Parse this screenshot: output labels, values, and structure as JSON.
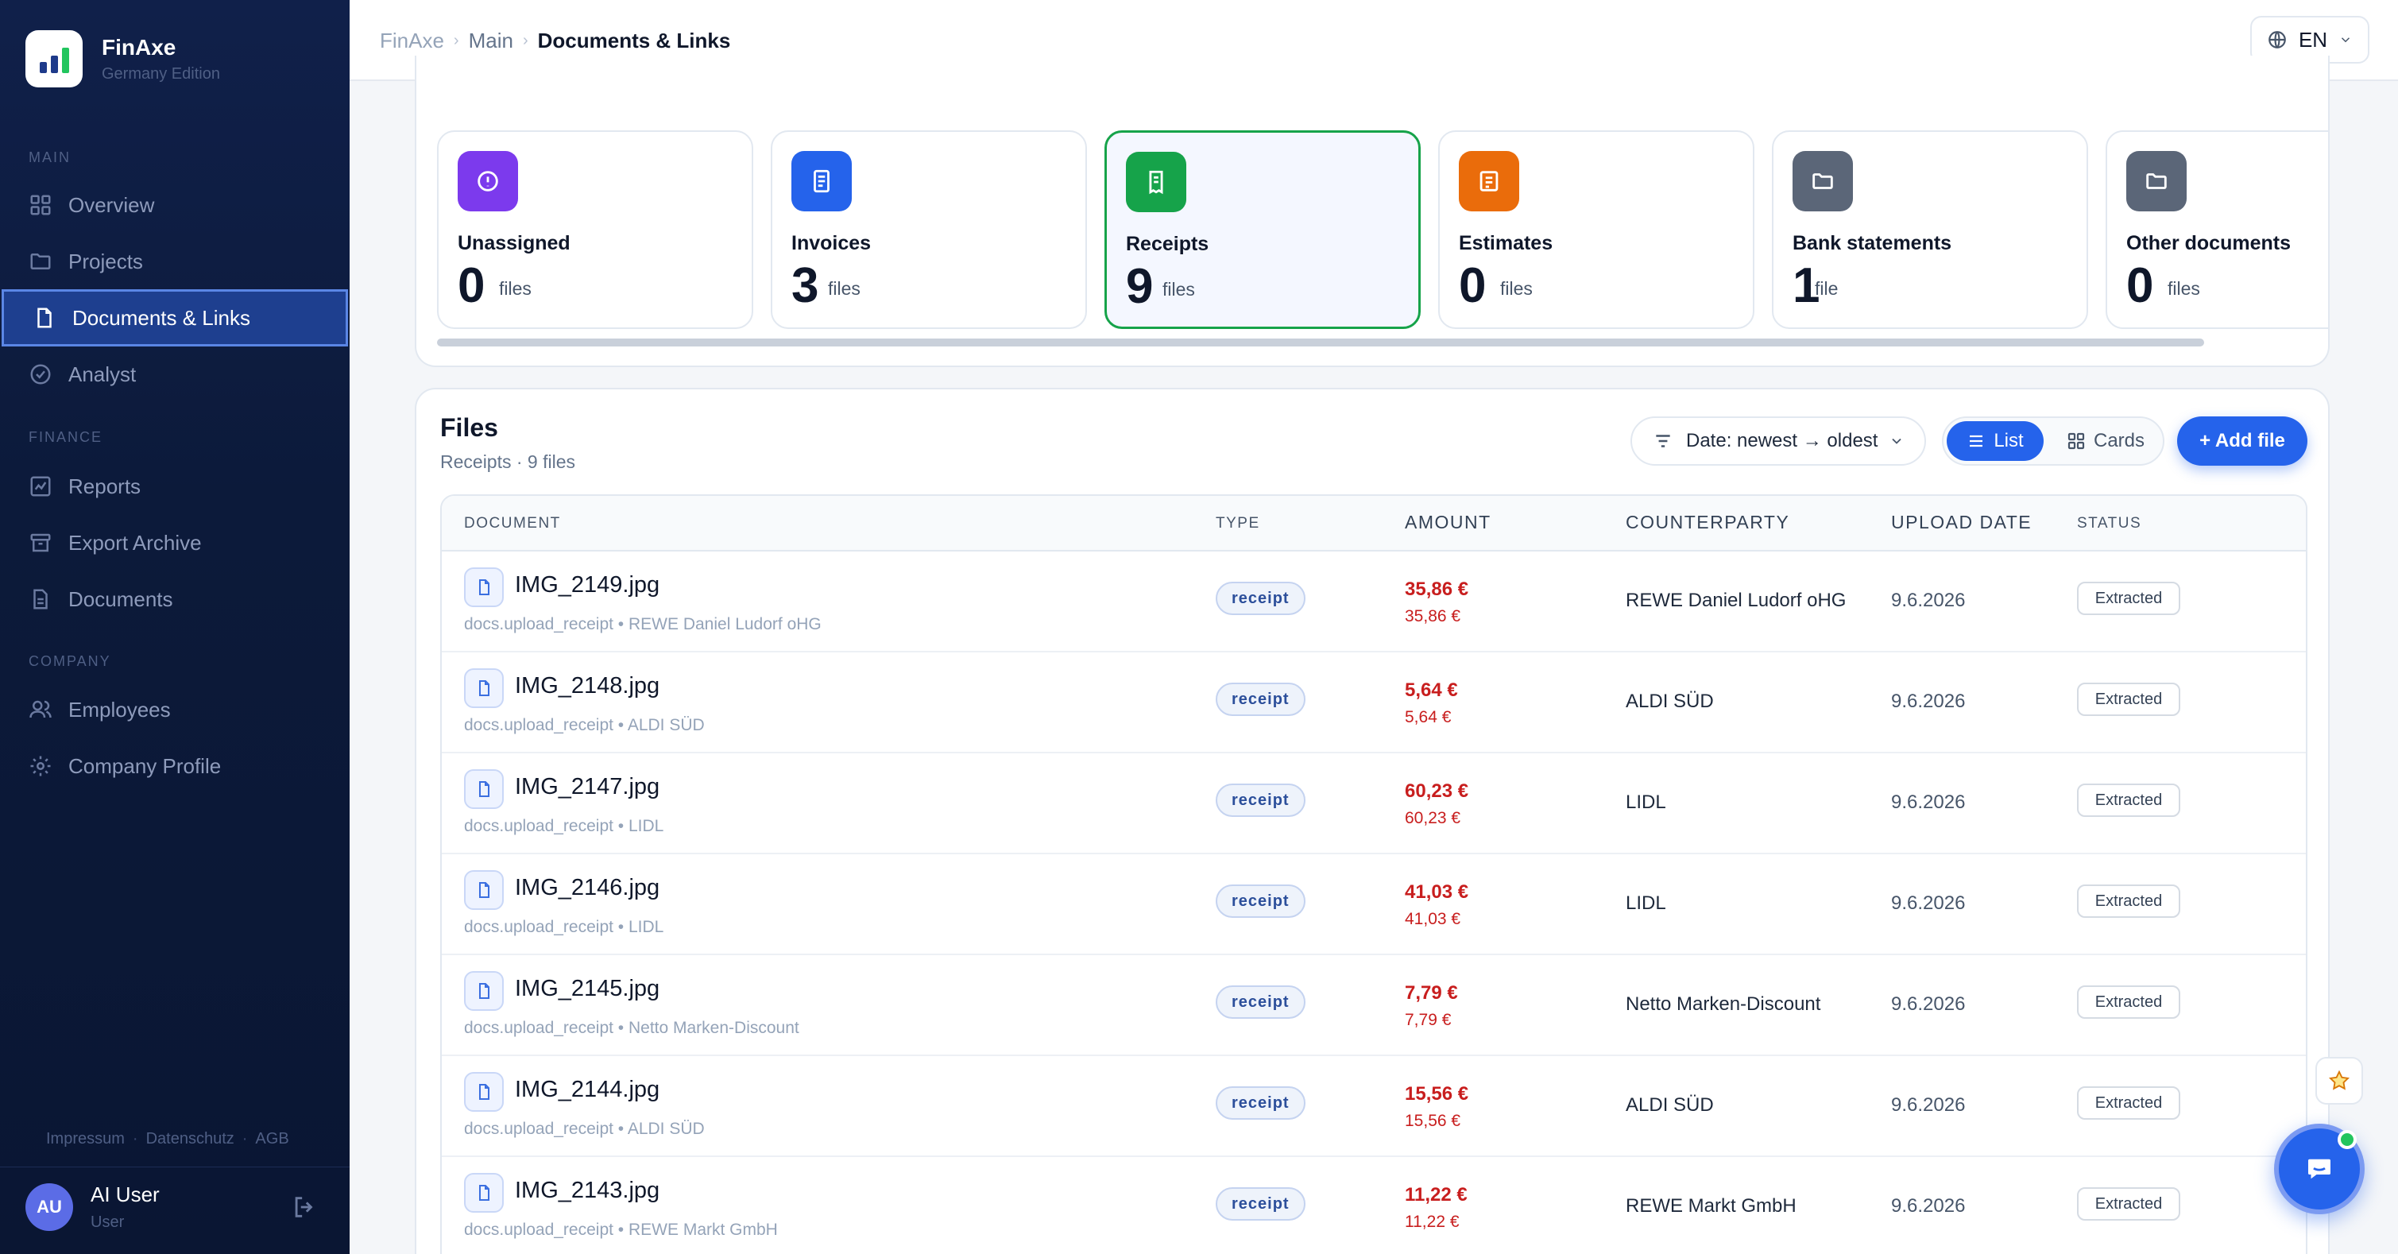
{
  "brand": {
    "name": "FinAxe",
    "edition": "Germany Edition"
  },
  "sidebar": {
    "sections": {
      "main": "MAIN",
      "finance": "FINANCE",
      "company": "COMPANY"
    },
    "items": [
      {
        "label": "Overview"
      },
      {
        "label": "Projects"
      },
      {
        "label": "Documents & Links"
      },
      {
        "label": "Analyst"
      },
      {
        "label": "Reports"
      },
      {
        "label": "Export Archive"
      },
      {
        "label": "Documents"
      },
      {
        "label": "Employees"
      },
      {
        "label": "Company Profile"
      }
    ],
    "footer_links": [
      "Impressum",
      "Datenschutz",
      "AGB"
    ],
    "user": {
      "initials": "AU",
      "name": "AI User",
      "role": "User"
    }
  },
  "topbar": {
    "breadcrumb": [
      "FinAxe",
      "Main",
      "Documents & Links"
    ],
    "language": "EN"
  },
  "categories": [
    {
      "name": "Unassigned",
      "count": "0",
      "unit": "files",
      "color": "#7c3aed"
    },
    {
      "name": "Invoices",
      "count": "3",
      "unit": "files",
      "color": "#2563eb"
    },
    {
      "name": "Receipts",
      "count": "9",
      "unit": "files",
      "color": "#16a34a"
    },
    {
      "name": "Estimates",
      "count": "0",
      "unit": "files",
      "color": "#ea6c0b"
    },
    {
      "name": "Bank statements",
      "count": "1",
      "unit": "file",
      "color": "#5b6678"
    },
    {
      "name": "Other documents",
      "count": "0",
      "unit": "files",
      "color": "#5b6678"
    }
  ],
  "files": {
    "title": "Files",
    "subtitle": "Receipts · 9 files",
    "sort_label": "Date: newest → oldest",
    "view_list": "List",
    "view_cards": "Cards",
    "add_label": "+ Add file",
    "columns": {
      "document": "DOCUMENT",
      "type": "TYPE",
      "amount": "AMOUNT",
      "counterparty": "COUNTERPARTY",
      "upload_date": "UPLOAD DATE",
      "status": "STATUS"
    },
    "rows": [
      {
        "name": "IMG_2149.jpg",
        "meta": "docs.upload_receipt • REWE Daniel Ludorf oHG",
        "type": "receipt",
        "amount": "35,86 €",
        "amount_sub": "35,86 €",
        "counterparty": "REWE Daniel Ludorf oHG",
        "date": "9.6.2026",
        "status": "Extracted"
      },
      {
        "name": "IMG_2148.jpg",
        "meta": "docs.upload_receipt • ALDI SÜD",
        "type": "receipt",
        "amount": "5,64 €",
        "amount_sub": "5,64 €",
        "counterparty": "ALDI SÜD",
        "date": "9.6.2026",
        "status": "Extracted"
      },
      {
        "name": "IMG_2147.jpg",
        "meta": "docs.upload_receipt • LIDL",
        "type": "receipt",
        "amount": "60,23 €",
        "amount_sub": "60,23 €",
        "counterparty": "LIDL",
        "date": "9.6.2026",
        "status": "Extracted"
      },
      {
        "name": "IMG_2146.jpg",
        "meta": "docs.upload_receipt • LIDL",
        "type": "receipt",
        "amount": "41,03 €",
        "amount_sub": "41,03 €",
        "counterparty": "LIDL",
        "date": "9.6.2026",
        "status": "Extracted"
      },
      {
        "name": "IMG_2145.jpg",
        "meta": "docs.upload_receipt • Netto Marken-Discount",
        "type": "receipt",
        "amount": "7,79 €",
        "amount_sub": "7,79 €",
        "counterparty": "Netto Marken-Discount",
        "date": "9.6.2026",
        "status": "Extracted"
      },
      {
        "name": "IMG_2144.jpg",
        "meta": "docs.upload_receipt • ALDI SÜD",
        "type": "receipt",
        "amount": "15,56 €",
        "amount_sub": "15,56 €",
        "counterparty": "ALDI SÜD",
        "date": "9.6.2026",
        "status": "Extracted"
      },
      {
        "name": "IMG_2143.jpg",
        "meta": "docs.upload_receipt • REWE Markt GmbH",
        "type": "receipt",
        "amount": "11,22 €",
        "amount_sub": "11,22 €",
        "counterparty": "REWE Markt GmbH",
        "date": "9.6.2026",
        "status": "Extracted"
      }
    ]
  },
  "icons": {
    "sidebar": [
      "grid-icon",
      "folder-icon",
      "file-icon",
      "check-circle-icon",
      "chart-icon",
      "archive-icon",
      "document-icon",
      "users-icon",
      "gear-icon"
    ],
    "categories": [
      "info-circle-icon",
      "invoice-icon",
      "receipt-icon",
      "estimate-icon",
      "folder-icon",
      "folder-icon"
    ]
  }
}
